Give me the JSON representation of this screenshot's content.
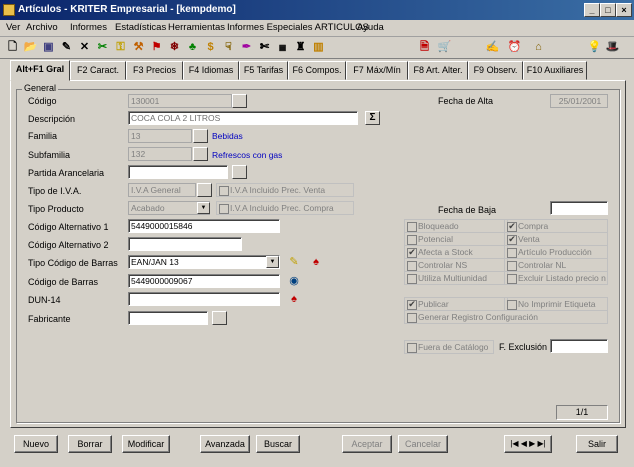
{
  "window": {
    "title": "Artículos - KRITER Empresarial - [kempdemo]",
    "min": "_",
    "max": "□",
    "close": "×"
  },
  "menu": [
    "Ver",
    "Archivo",
    "Informes",
    "Estadísticas",
    "Herramientas",
    "Informes Especiales ARTICULOS",
    "Ayuda"
  ],
  "tabs": [
    "Alt+F1 Gral",
    "F2 Caract.",
    "F3 Precios",
    "F4 Idiomas",
    "F5 Tarifas",
    "F6 Compos.",
    "F7 Máx/Mín",
    "F8 Art. Alter.",
    "F9 Observ.",
    "F10 Auxiliares"
  ],
  "group_label": "General",
  "form": {
    "codigo_label": "Código",
    "codigo": "130001",
    "descripcion_label": "Descripción",
    "descripcion": "COCA COLA 2 LITROS",
    "familia_label": "Familia",
    "familia": "13",
    "familia_name": "Bebidas",
    "subfamilia_label": "Subfamilia",
    "subfamilia": "132",
    "subfamilia_name": "Refrescos con gas",
    "partida_label": "Partida Arancelaria",
    "partida": "",
    "iva_label": "Tipo de I.V.A.",
    "iva": "I.V.A General",
    "iva_incl_venta": "I.V.A Incluido Prec. Venta",
    "tipo_producto_label": "Tipo Producto",
    "tipo_producto": "Acabado",
    "iva_incl_compra": "I.V.A Incluido Prec. Compra",
    "alt1_label": "Código Alternativo 1",
    "alt1": "5449000015846",
    "alt2_label": "Código Alternativo 2",
    "alt2": "",
    "tipo_barras_label": "Tipo Código de Barras",
    "tipo_barras": "EAN/JAN 13",
    "barras_label": "Código de Barras",
    "barras": "5449000009067",
    "dun_label": "DUN-14",
    "dun": "",
    "fabricante_label": "Fabricante",
    "fabricante": "",
    "fecha_alta_label": "Fecha de Alta",
    "fecha_alta": "25/01/2001",
    "fecha_baja_label": "Fecha de Baja",
    "fecha_baja": "",
    "f_exclusion_label": "F. Exclusión",
    "f_exclusion": "",
    "sigma": "Σ",
    "page": "1/1"
  },
  "checks_left": [
    {
      "label": "Bloqueado",
      "checked": false
    },
    {
      "label": "Potencial",
      "checked": false
    },
    {
      "label": "Afecta a Stock",
      "checked": true
    },
    {
      "label": "Controlar NS",
      "checked": false
    },
    {
      "label": "Utiliza Multiunidad",
      "checked": false
    }
  ],
  "checks_right": [
    {
      "label": "Compra",
      "checked": true
    },
    {
      "label": "Venta",
      "checked": true
    },
    {
      "label": "Artículo Producción",
      "checked": false
    },
    {
      "label": "Controlar NL",
      "checked": false
    },
    {
      "label": "Excluir Listado precio n",
      "checked": false
    }
  ],
  "checks_extra": {
    "publicar": "Publicar",
    "no_imprimir": "No Imprimir Etiqueta",
    "generar": "Generar Registro Configuración",
    "fuera": "Fuera de Catálogo"
  },
  "buttons": {
    "nuevo": "Nuevo",
    "borrar": "Borrar",
    "modificar": "Modificar",
    "avanzada": "Avanzada",
    "buscar": "Buscar",
    "aceptar": "Aceptar",
    "cancelar": "Cancelar",
    "salir": "Salir",
    "nav": "|◀ ◀ ▶ ▶|"
  }
}
